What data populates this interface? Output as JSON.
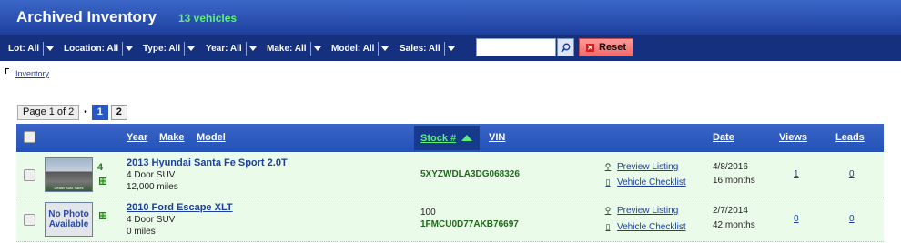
{
  "header": {
    "title": "Archived Inventory",
    "count": "13 vehicles"
  },
  "filters": [
    {
      "label": "Lot: All"
    },
    {
      "label": "Location: All"
    },
    {
      "label": "Type: All"
    },
    {
      "label": "Year: All"
    },
    {
      "label": "Make: All"
    },
    {
      "label": "Model: All"
    },
    {
      "label": "Sales: All"
    }
  ],
  "search": {
    "value": "",
    "placeholder": ""
  },
  "reset_label": "Reset",
  "breadcrumb": "Inventory",
  "pager": {
    "info": "Page 1 of 2",
    "separator": "•",
    "pages": [
      "1",
      "2"
    ],
    "current": "1"
  },
  "table": {
    "headers": {
      "year": "Year",
      "make": "Make",
      "model": "Model",
      "stock": "Stock #",
      "vin": "VIN",
      "date": "Date",
      "views": "Views",
      "leads": "Leads"
    },
    "rows": [
      {
        "photo_count": "4",
        "thumb_caption": "Dealer Auto Sales",
        "title": "2013 Hyundai Santa Fe Sport 2.0T",
        "body": "4 Door SUV",
        "miles": "12,000 miles",
        "stock": "",
        "vin": "5XYZWDLA3DG068326",
        "preview": "Preview Listing",
        "checklist": "Vehicle Checklist",
        "date": "4/8/2016",
        "age": "16 months",
        "views": "1",
        "leads": "0"
      },
      {
        "photo_count": "",
        "thumb_text": "No Photo Available",
        "title": "2010 Ford Escape XLT",
        "body": "4 Door SUV",
        "miles": "0 miles",
        "stock": "100",
        "vin": "1FMCU0D77AKB76697",
        "preview": "Preview Listing",
        "checklist": "Vehicle Checklist",
        "date": "2/7/2014",
        "age": "42 months",
        "views": "0",
        "leads": "0"
      }
    ]
  },
  "colors": {
    "header_blue": "#2452b8",
    "accent_green": "#5cf07a",
    "row_green": "#eafbe9",
    "link_blue": "#1c3f9e",
    "reset_red": "#f06a6a"
  },
  "icons": {
    "search": "magnifier-icon",
    "reset": "x-icon",
    "preview": "magnifier-icon",
    "checklist": "clipboard-icon",
    "photos": "grid-icon"
  }
}
